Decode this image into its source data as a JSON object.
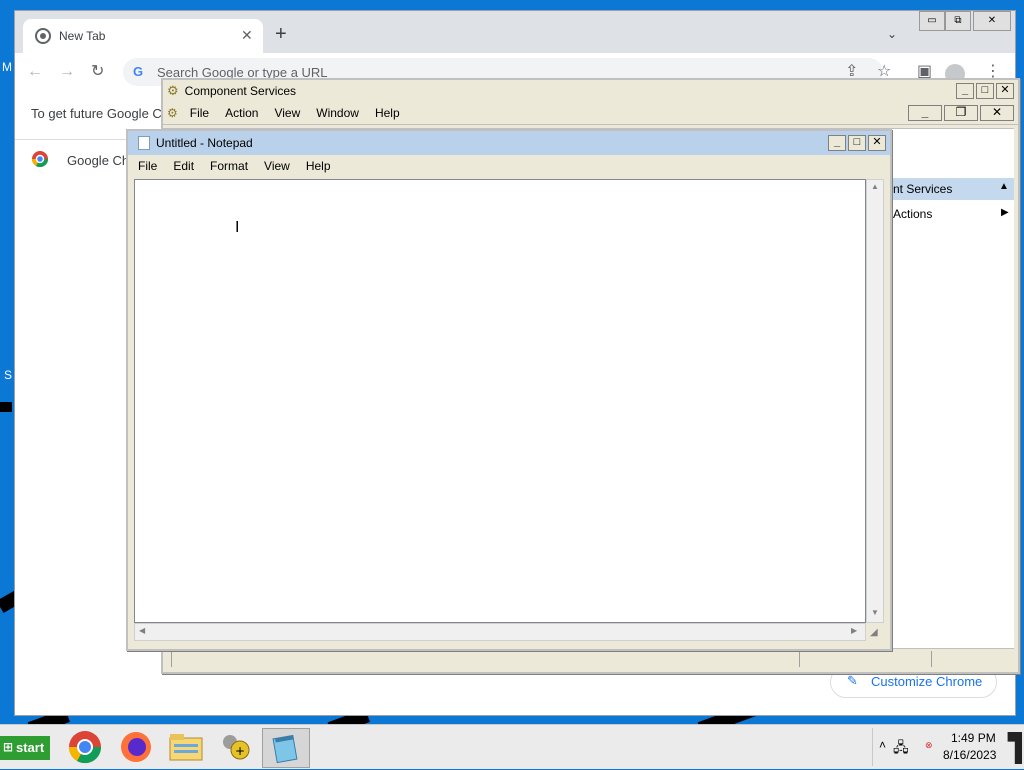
{
  "desktop": {
    "fragment_top": "M",
    "fragment_mid": "S"
  },
  "chrome": {
    "tab_title": "New Tab",
    "new_tab": "+",
    "omnibox_placeholder": "Search Google or type a URL",
    "signin_text": "To get future Google C",
    "bookmark_label": "Google Ch",
    "customize_label": "Customize Chrome",
    "window_controls": {
      "minimize": "▭",
      "restore": "⧉",
      "close": "✕"
    }
  },
  "component_services": {
    "title": "Component Services",
    "menu": [
      "File",
      "Action",
      "View",
      "Window",
      "Help"
    ],
    "actions_header": "nt Services",
    "actions_item": "Actions"
  },
  "notepad": {
    "title": "Untitled - Notepad",
    "menu": [
      "File",
      "Edit",
      "Format",
      "View",
      "Help"
    ],
    "content": ""
  },
  "taskbar": {
    "start_label": "start",
    "time": "1:49 PM",
    "date": "8/16/2023"
  },
  "colors": {
    "desktop_blue": "#0a78d4",
    "chrome_frame": "#dee1e6",
    "notepad_title": "#b9d1ea",
    "start_green": "#2e9d32"
  }
}
